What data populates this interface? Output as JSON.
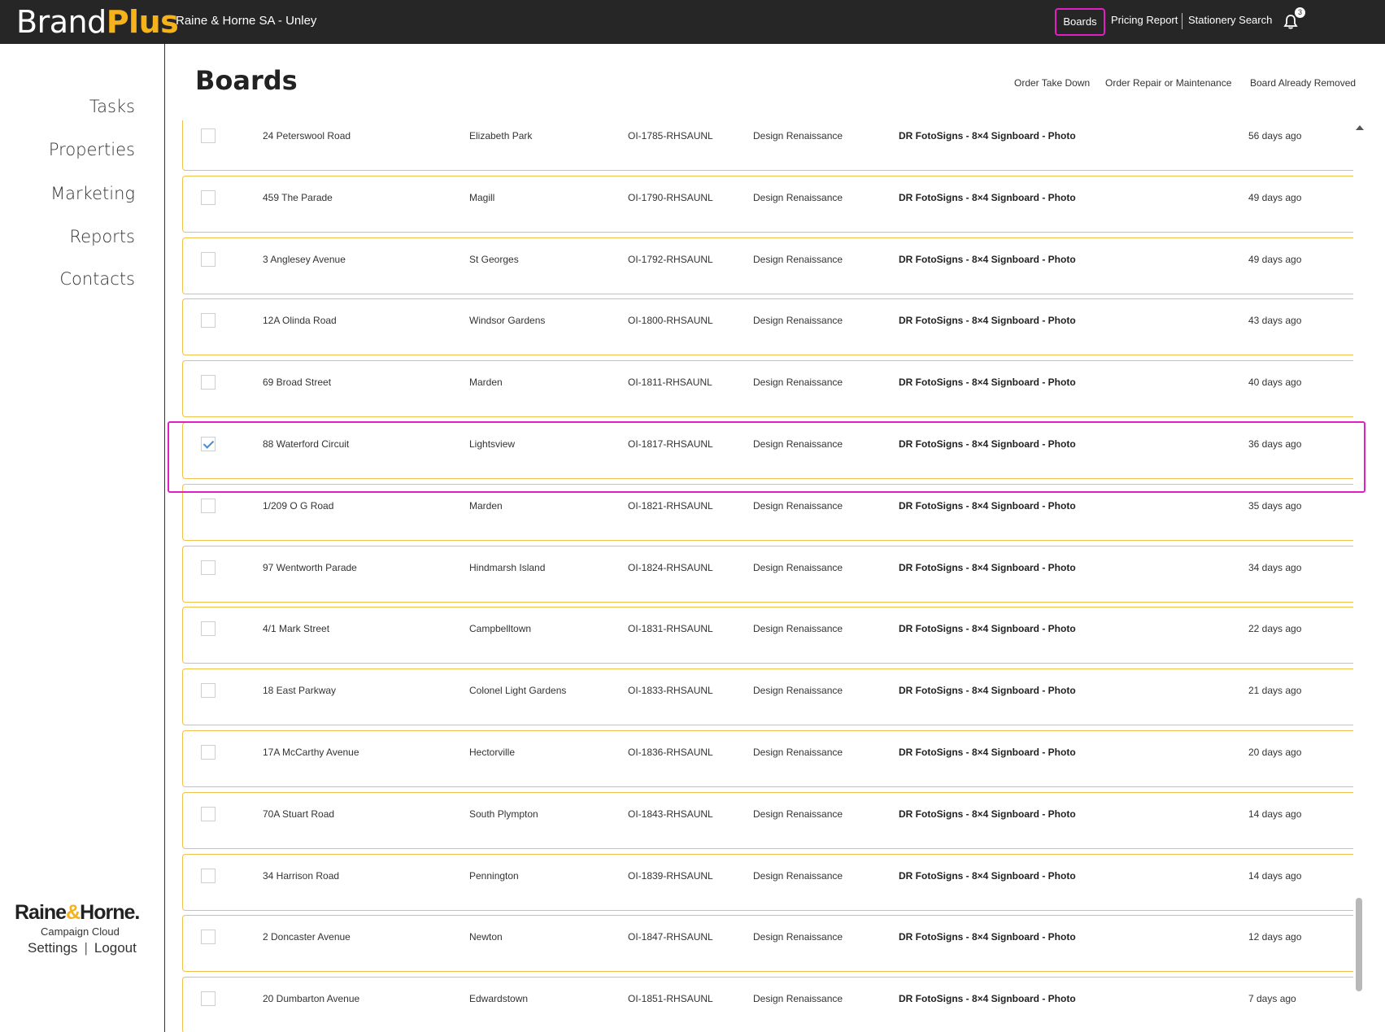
{
  "app": {
    "brand": "Brand",
    "brand_accent": "Plus",
    "office": "Raine & Horne SA - Unley"
  },
  "topnav": {
    "boards": "Boards",
    "pricing_report": "Pricing Report",
    "stationery_search": "Stationery Search",
    "notifications_count": "3"
  },
  "sidebar": {
    "items": [
      {
        "label": "Tasks"
      },
      {
        "label": "Properties"
      },
      {
        "label": "Marketing"
      },
      {
        "label": "Reports"
      },
      {
        "label": "Contacts"
      }
    ],
    "footer": {
      "logo_left": "Raine",
      "logo_amp": "&",
      "logo_right": "Horne.",
      "subtitle": "Campaign Cloud",
      "settings": "Settings",
      "separator": "|",
      "logout": "Logout"
    }
  },
  "main": {
    "title": "Boards",
    "actions": {
      "take_down": "Order Take Down",
      "repair": "Order Repair or Maintenance",
      "removed": "Board Already Removed"
    },
    "rows": [
      {
        "address": "24 Peterswool Road",
        "suburb": "Elizabeth Park",
        "ref": "OI-1785-RHSAUNL",
        "supplier": "Design Renaissance",
        "product": "DR FotoSigns - 8×4 Signboard - Photo",
        "age": "56 days ago",
        "checked": false
      },
      {
        "address": "459 The Parade",
        "suburb": "Magill",
        "ref": "OI-1790-RHSAUNL",
        "supplier": "Design Renaissance",
        "product": "DR FotoSigns - 8×4 Signboard - Photo",
        "age": "49 days ago",
        "checked": false
      },
      {
        "address": "3 Anglesey Avenue",
        "suburb": "St Georges",
        "ref": "OI-1792-RHSAUNL",
        "supplier": "Design Renaissance",
        "product": "DR FotoSigns - 8×4 Signboard - Photo",
        "age": "49 days ago",
        "checked": false
      },
      {
        "address": "12A Olinda Road",
        "suburb": "Windsor Gardens",
        "ref": "OI-1800-RHSAUNL",
        "supplier": "Design Renaissance",
        "product": "DR FotoSigns - 8×4 Signboard - Photo",
        "age": "43 days ago",
        "checked": false
      },
      {
        "address": "69 Broad Street",
        "suburb": "Marden",
        "ref": "OI-1811-RHSAUNL",
        "supplier": "Design Renaissance",
        "product": "DR FotoSigns - 8×4 Signboard - Photo",
        "age": "40 days ago",
        "checked": false
      },
      {
        "address": "88 Waterford Circuit",
        "suburb": "Lightsview",
        "ref": "OI-1817-RHSAUNL",
        "supplier": "Design Renaissance",
        "product": "DR FotoSigns - 8×4 Signboard - Photo",
        "age": "36 days ago",
        "checked": true
      },
      {
        "address": "1/209 O G Road",
        "suburb": "Marden",
        "ref": "OI-1821-RHSAUNL",
        "supplier": "Design Renaissance",
        "product": "DR FotoSigns - 8×4 Signboard - Photo",
        "age": "35 days ago",
        "checked": false
      },
      {
        "address": "97 Wentworth Parade",
        "suburb": "Hindmarsh Island",
        "ref": "OI-1824-RHSAUNL",
        "supplier": "Design Renaissance",
        "product": "DR FotoSigns - 8×4 Signboard - Photo",
        "age": "34 days ago",
        "checked": false
      },
      {
        "address": "4/1 Mark Street",
        "suburb": "Campbelltown",
        "ref": "OI-1831-RHSAUNL",
        "supplier": "Design Renaissance",
        "product": "DR FotoSigns - 8×4 Signboard - Photo",
        "age": "22 days ago",
        "checked": false
      },
      {
        "address": "18 East Parkway",
        "suburb": "Colonel Light Gardens",
        "ref": "OI-1833-RHSAUNL",
        "supplier": "Design Renaissance",
        "product": "DR FotoSigns - 8×4 Signboard - Photo",
        "age": "21 days ago",
        "checked": false
      },
      {
        "address": "17A McCarthy Avenue",
        "suburb": "Hectorville",
        "ref": "OI-1836-RHSAUNL",
        "supplier": "Design Renaissance",
        "product": "DR FotoSigns - 8×4 Signboard - Photo",
        "age": "20 days ago",
        "checked": false
      },
      {
        "address": "70A Stuart Road",
        "suburb": "South Plympton",
        "ref": "OI-1843-RHSAUNL",
        "supplier": "Design Renaissance",
        "product": "DR FotoSigns - 8×4 Signboard - Photo",
        "age": "14 days ago",
        "checked": false
      },
      {
        "address": "34 Harrison Road",
        "suburb": "Pennington",
        "ref": "OI-1839-RHSAUNL",
        "supplier": "Design Renaissance",
        "product": "DR FotoSigns - 8×4 Signboard - Photo",
        "age": "14 days ago",
        "checked": false
      },
      {
        "address": "2 Doncaster Avenue",
        "suburb": "Newton",
        "ref": "OI-1847-RHSAUNL",
        "supplier": "Design Renaissance",
        "product": "DR FotoSigns - 8×4 Signboard - Photo",
        "age": "12 days ago",
        "checked": false
      },
      {
        "address": "20 Dumbarton Avenue",
        "suburb": "Edwardstown",
        "ref": "OI-1851-RHSAUNL",
        "supplier": "Design Renaissance",
        "product": "DR FotoSigns - 8×4 Signboard - Photo",
        "age": "7 days ago",
        "checked": false
      }
    ]
  },
  "colors": {
    "accent": "#f5b21a",
    "highlight": "#e21fc5",
    "row_border": "#f0c24b",
    "topbar": "#262626",
    "check": "#3b8fe0"
  },
  "icons": {
    "notifications": "bell-icon",
    "checkbox_checked": "checkmark-icon",
    "scroll_up": "chevron-up-icon"
  }
}
